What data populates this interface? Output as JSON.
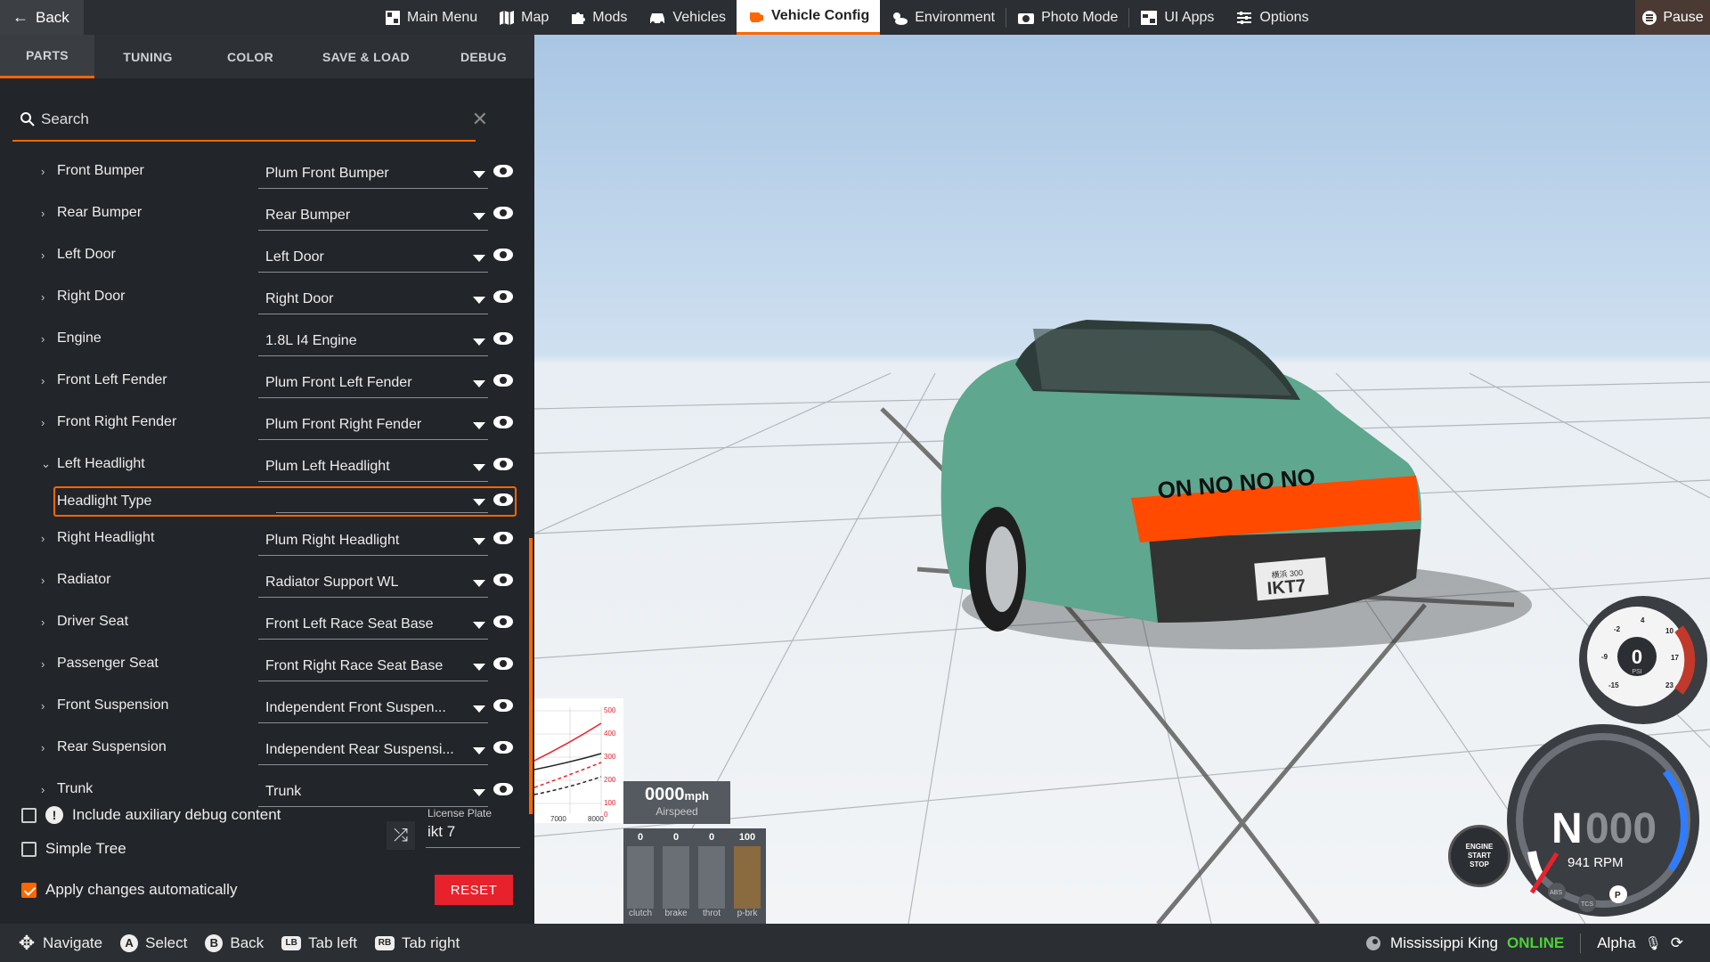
{
  "topbar": {
    "back_label": "Back",
    "nav": [
      {
        "label": "Main Menu",
        "icon": "main-menu-icon"
      },
      {
        "label": "Map",
        "icon": "map-icon"
      },
      {
        "label": "Mods",
        "icon": "puzzle-icon"
      },
      {
        "label": "Vehicles",
        "icon": "car-icon"
      },
      {
        "label": "Vehicle Config",
        "icon": "engine-icon",
        "active": true
      },
      {
        "label": "Environment",
        "icon": "weather-icon"
      },
      {
        "label": "Photo Mode",
        "icon": "camera-icon"
      },
      {
        "label": "UI Apps",
        "icon": "ui-apps-icon"
      },
      {
        "label": "Options",
        "icon": "sliders-icon"
      }
    ],
    "pause_label": "Pause"
  },
  "tabs": [
    "PARTS",
    "TUNING",
    "COLOR",
    "SAVE & LOAD",
    "DEBUG"
  ],
  "active_tab": "PARTS",
  "search": {
    "placeholder": "Search"
  },
  "parts": [
    {
      "name": "Front Bumper",
      "value": "Plum Front Bumper"
    },
    {
      "name": "Rear Bumper",
      "value": "Rear Bumper"
    },
    {
      "name": "Left Door",
      "value": "Left Door"
    },
    {
      "name": "Right Door",
      "value": "Right Door"
    },
    {
      "name": "Engine",
      "value": "1.8L I4 Engine"
    },
    {
      "name": "Front Left Fender",
      "value": "Plum Front Left Fender"
    },
    {
      "name": "Front Right Fender",
      "value": "Plum Front Right Fender"
    },
    {
      "name": "Left Headlight",
      "value": "Plum Left Headlight",
      "expanded": true
    },
    {
      "name": "Headlight Type",
      "value": "",
      "sub": true
    },
    {
      "name": "Right Headlight",
      "value": "Plum Right Headlight"
    },
    {
      "name": "Radiator",
      "value": "Radiator Support WL"
    },
    {
      "name": "Driver Seat",
      "value": "Front Left Race Seat Base"
    },
    {
      "name": "Passenger Seat",
      "value": "Front Right Race Seat Base"
    },
    {
      "name": "Front Suspension",
      "value": "Independent Front Suspen..."
    },
    {
      "name": "Rear Suspension",
      "value": "Independent Rear Suspensi..."
    },
    {
      "name": "Trunk",
      "value": "Trunk"
    }
  ],
  "options": {
    "aux_debug": "Include auxiliary debug content",
    "simple_tree": "Simple Tree",
    "apply_auto": "Apply changes automatically"
  },
  "license_plate": {
    "label": "License Plate",
    "value": "ikt 7"
  },
  "reset_label": "RESET",
  "graph": {
    "right_ticks": [
      "500",
      "400",
      "300",
      "200",
      "100",
      "0"
    ],
    "bottom_ticks": [
      "7000",
      "8000"
    ]
  },
  "airspeed": {
    "value": "0000",
    "unit": "mph",
    "label": "Airspeed"
  },
  "pedals": [
    {
      "value": "0",
      "label": "clutch"
    },
    {
      "value": "0",
      "label": "brake"
    },
    {
      "value": "0",
      "label": "throt"
    },
    {
      "value": "100",
      "label": "p-brk"
    }
  ],
  "boost_gauge": {
    "value": "0",
    "unit": "PSI",
    "ticks": [
      "-2",
      "4",
      "10",
      "-9",
      "17",
      "-15",
      "23"
    ]
  },
  "tacho": {
    "gear": "N",
    "speed": "000",
    "rpm": "941 RPM",
    "indicators": [
      "ABS",
      "TCS",
      "P"
    ]
  },
  "start_stop": [
    "ENGINE",
    "START",
    "STOP"
  ],
  "bottombar": {
    "hints": [
      {
        "glyph": "✥",
        "label": "Navigate"
      },
      {
        "glyph": "A",
        "label": "Select"
      },
      {
        "glyph": "B",
        "label": "Back"
      },
      {
        "glyph": "LB",
        "label": "Tab left"
      },
      {
        "glyph": "RB",
        "label": "Tab right"
      }
    ],
    "user": "Mississippi King",
    "status": "ONLINE",
    "build": "Alpha"
  },
  "plate_text": "IKT7",
  "plate_top": "横浜 300",
  "windshield_banner": "ON NO NO NO",
  "colors": {
    "accent": "#ff6600",
    "reset": "#e8222c",
    "online": "#4cd137",
    "car": "#5fa78f"
  }
}
